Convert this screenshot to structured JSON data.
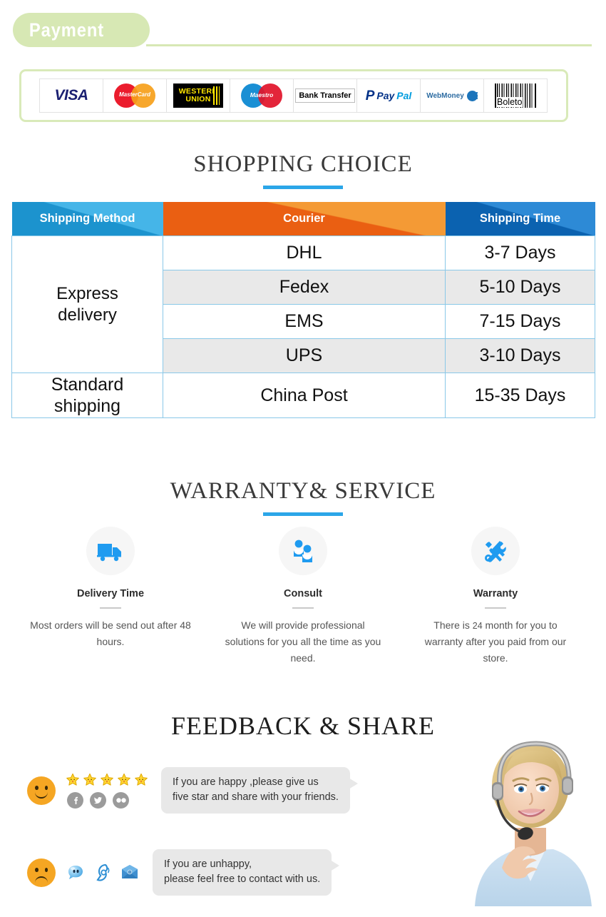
{
  "payment": {
    "banner_label": "Payment",
    "methods": [
      {
        "name": "visa",
        "label": "VISA"
      },
      {
        "name": "mastercard",
        "label": "MasterCard"
      },
      {
        "name": "western-union",
        "label_line1": "WESTERN",
        "label_line2": "UNION"
      },
      {
        "name": "maestro",
        "label": "Maestro"
      },
      {
        "name": "bank-transfer",
        "label": "Bank Transfer"
      },
      {
        "name": "paypal",
        "label_p": "Pay",
        "label_pal": "Pal"
      },
      {
        "name": "webmoney",
        "label": "WebMoney"
      },
      {
        "name": "boleto",
        "label": "Boleto"
      }
    ]
  },
  "shopping": {
    "title": "SHOPPING CHOICE",
    "table": {
      "headers": [
        "Shipping Method",
        "Courier",
        "Shipping Time"
      ],
      "rows": [
        {
          "method": "Express\ndelivery",
          "courier": "DHL",
          "time": "3-7  Days"
        },
        {
          "method": "",
          "courier": "Fedex",
          "time": "5-10 Days"
        },
        {
          "method": "",
          "courier": "EMS",
          "time": "7-15 Days"
        },
        {
          "method": "",
          "courier": "UPS",
          "time": "3-10 Days"
        },
        {
          "method": "Standard\nshipping",
          "courier": "China Post",
          "time": "15-35 Days"
        }
      ],
      "express_method_label_line1": "Express",
      "express_method_label_line2": "delivery",
      "standard_method_label_line1": "Standard",
      "standard_method_label_line2": "shipping"
    }
  },
  "warranty": {
    "title": "WARRANTY& SERVICE",
    "cards": [
      {
        "icon": "truck-icon",
        "heading": "Delivery Time",
        "body": "Most orders will be send out after 48 hours."
      },
      {
        "icon": "people-icon",
        "heading": "Consult",
        "body": "We will provide professional solutions for you all the time as you need."
      },
      {
        "icon": "tools-icon",
        "heading": "Warranty",
        "body_pre": "There is",
        "body_num": "24",
        "body_post": "month for you to warranty after you paid from our store."
      }
    ]
  },
  "feedback": {
    "title": "FEEDBACK & SHARE",
    "happy": {
      "emoji": "happy-face",
      "star_count": 5,
      "socials": [
        "facebook-icon",
        "twitter-icon",
        "flickr-icon"
      ],
      "message_line1": "If you are happy ,please give us",
      "message_line2": "five star and share with your friends."
    },
    "unhappy": {
      "emoji": "sad-face",
      "icons": [
        "chat-icon",
        "phone-icon",
        "mail-icon"
      ],
      "message_line1": "If you are unhappy,",
      "message_line2": "please feel free to contact with us."
    },
    "photo_alt": "customer-service-agent-photo"
  },
  "colors": {
    "banner_green": "#d7e8b4",
    "accent_blue": "#2ba6e8",
    "header_blue": "#29a3dc",
    "header_orange": "#f08320",
    "header_dark_blue": "#1878c8",
    "icon_blue": "#1f9bf0",
    "star_yellow": "#ffd633",
    "emoji_orange": "#f5a623"
  }
}
